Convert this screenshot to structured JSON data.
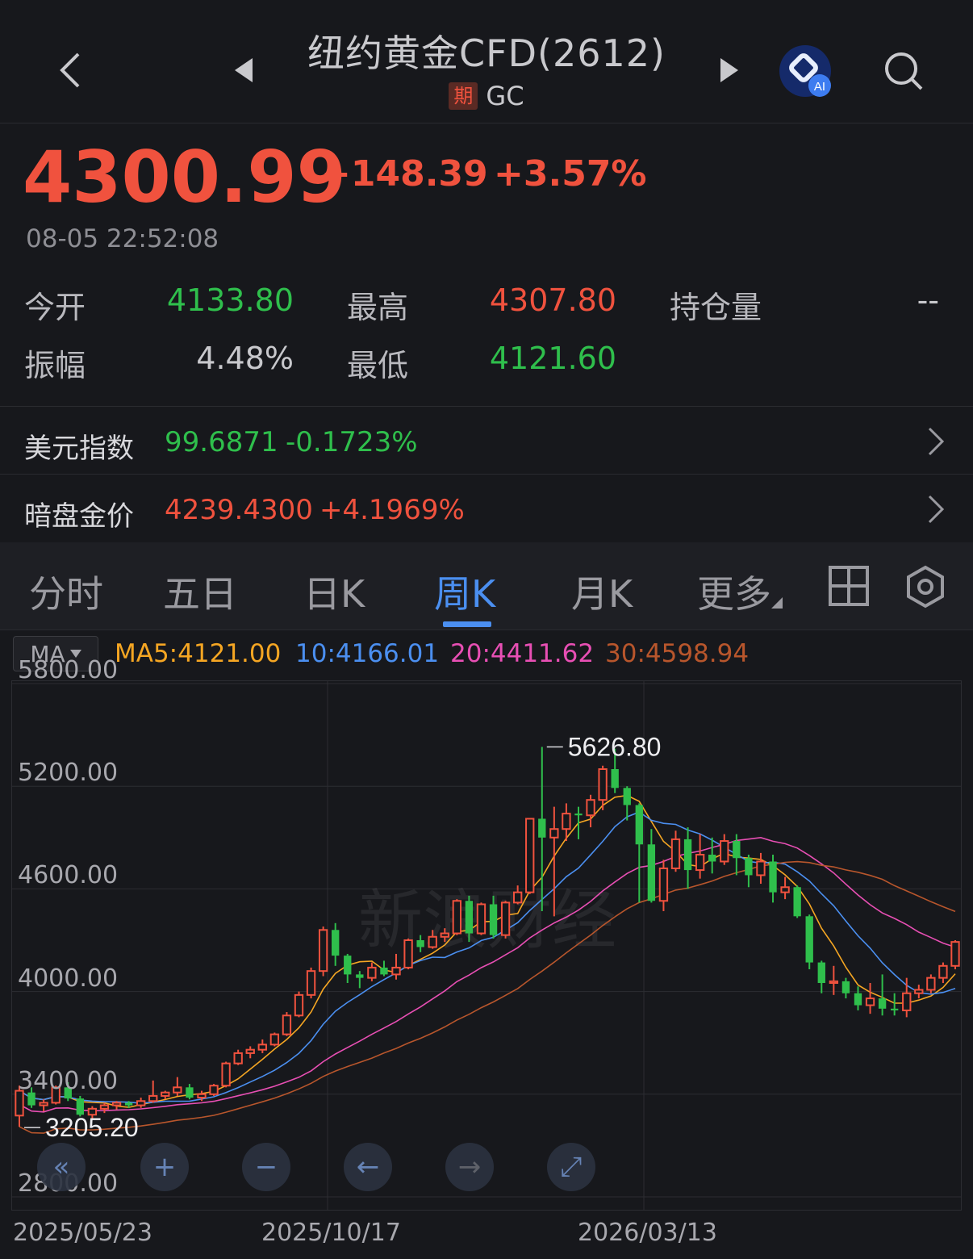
{
  "header": {
    "title": "纽约黄金CFD(2612)",
    "badge": "期",
    "code": "GC"
  },
  "quote": {
    "price": "4300.99",
    "change": "+148.39",
    "change_pct": "+3.57%",
    "time": "08-05 22:52:08",
    "open_label": "今开",
    "open": "4133.80",
    "high_label": "最高",
    "high": "4307.80",
    "oi_label": "持仓量",
    "oi": "--",
    "amp_label": "振幅",
    "amp": "4.48%",
    "low_label": "最低",
    "low": "4121.60"
  },
  "related": [
    {
      "label": "美元指数",
      "value": "99.6871",
      "change": "-0.1723%"
    },
    {
      "label": "暗盘金价",
      "value": "4239.4300",
      "change": "+4.1969%"
    }
  ],
  "tabs": [
    {
      "label": "分时"
    },
    {
      "label": "五日"
    },
    {
      "label": "日K"
    },
    {
      "label": "周K"
    },
    {
      "label": "月K"
    },
    {
      "label": "更多"
    }
  ],
  "ma": {
    "selector": "MA",
    "ma5": "MA5:4121.00",
    "ma10": "10:4166.01",
    "ma20": "20:4411.62",
    "ma30": "30:4598.94",
    "colors": {
      "ma5": "#f5a623",
      "ma10": "#4b8ff0",
      "ma20": "#e84fb4",
      "ma30": "#b8562c"
    }
  },
  "colors": {
    "up": "#f0523e",
    "down": "#2fbf4c",
    "accent": "#4b8ff0"
  },
  "chart_data": {
    "type": "candlestick",
    "y_ticks": [
      "5800.00",
      "5200.00",
      "4600.00",
      "4000.00",
      "3400.00",
      "2800.00"
    ],
    "ylim": [
      2800,
      5800
    ],
    "x_ticks": [
      "2025/05/23",
      "2025/10/17",
      "2026/03/13"
    ],
    "max_label": "5626.80",
    "min_label": "3205.20",
    "watermark": "新浪财经",
    "candles": [
      [
        3275,
        3420,
        3210,
        3450
      ],
      [
        3410,
        3335,
        3320,
        3440
      ],
      [
        3335,
        3350,
        3300,
        3370
      ],
      [
        3350,
        3440,
        3340,
        3450
      ],
      [
        3440,
        3375,
        3360,
        3470
      ],
      [
        3375,
        3280,
        3270,
        3390
      ],
      [
        3280,
        3315,
        3260,
        3330
      ],
      [
        3315,
        3335,
        3290,
        3350
      ],
      [
        3335,
        3350,
        3310,
        3360
      ],
      [
        3350,
        3335,
        3320,
        3360
      ],
      [
        3335,
        3360,
        3320,
        3380
      ],
      [
        3360,
        3390,
        3350,
        3480
      ],
      [
        3390,
        3410,
        3370,
        3420
      ],
      [
        3410,
        3440,
        3390,
        3500
      ],
      [
        3440,
        3380,
        3370,
        3460
      ],
      [
        3380,
        3400,
        3360,
        3420
      ],
      [
        3400,
        3450,
        3390,
        3460
      ],
      [
        3450,
        3580,
        3440,
        3590
      ],
      [
        3580,
        3640,
        3570,
        3660
      ],
      [
        3640,
        3660,
        3610,
        3680
      ],
      [
        3660,
        3690,
        3640,
        3720
      ],
      [
        3690,
        3750,
        3680,
        3760
      ],
      [
        3750,
        3860,
        3740,
        3880
      ],
      [
        3860,
        3980,
        3850,
        4000
      ],
      [
        3980,
        4120,
        3960,
        4140
      ],
      [
        4120,
        4360,
        4090,
        4380
      ],
      [
        4360,
        4210,
        4150,
        4400
      ],
      [
        4210,
        4100,
        4050,
        4220
      ],
      [
        4100,
        4080,
        4020,
        4120
      ],
      [
        4080,
        4140,
        4060,
        4170
      ],
      [
        4140,
        4100,
        4090,
        4180
      ],
      [
        4100,
        4140,
        4070,
        4220
      ],
      [
        4140,
        4300,
        4130,
        4310
      ],
      [
        4300,
        4260,
        4230,
        4330
      ],
      [
        4260,
        4320,
        4250,
        4360
      ],
      [
        4320,
        4340,
        4290,
        4370
      ],
      [
        4340,
        4530,
        4330,
        4540
      ],
      [
        4530,
        4340,
        4290,
        4560
      ],
      [
        4340,
        4510,
        4330,
        4520
      ],
      [
        4510,
        4330,
        4310,
        4560
      ],
      [
        4330,
        4520,
        4310,
        4530
      ],
      [
        4520,
        4580,
        4510,
        4620
      ],
      [
        4580,
        5010,
        4570,
        5010
      ],
      [
        5010,
        4900,
        4470,
        5430
      ],
      [
        4900,
        4950,
        4440,
        5080
      ],
      [
        4950,
        5040,
        4880,
        5100
      ],
      [
        5040,
        5030,
        4890,
        5080
      ],
      [
        5030,
        5120,
        4960,
        5150
      ],
      [
        5120,
        5300,
        5060,
        5320
      ],
      [
        5300,
        5190,
        5160,
        5420
      ],
      [
        5190,
        5090,
        5000,
        5200
      ],
      [
        5090,
        4860,
        4520,
        5100
      ],
      [
        4860,
        4530,
        4520,
        4950
      ],
      [
        4530,
        4720,
        4470,
        4770
      ],
      [
        4720,
        4890,
        4700,
        4940
      ],
      [
        4890,
        4710,
        4600,
        4960
      ],
      [
        4710,
        4800,
        4660,
        4920
      ],
      [
        4800,
        4760,
        4690,
        4900
      ],
      [
        4760,
        4880,
        4740,
        4920
      ],
      [
        4880,
        4780,
        4680,
        4920
      ],
      [
        4780,
        4680,
        4610,
        4800
      ],
      [
        4680,
        4760,
        4630,
        4810
      ],
      [
        4760,
        4580,
        4520,
        4800
      ],
      [
        4580,
        4610,
        4540,
        4670
      ],
      [
        4610,
        4440,
        4430,
        4620
      ],
      [
        4440,
        4170,
        4130,
        4450
      ],
      [
        4170,
        4050,
        3990,
        4180
      ],
      [
        4050,
        4060,
        3980,
        4150
      ],
      [
        4060,
        3990,
        3960,
        4080
      ],
      [
        3990,
        3920,
        3890,
        4030
      ],
      [
        3920,
        3960,
        3870,
        4050
      ],
      [
        3960,
        3900,
        3860,
        4100
      ],
      [
        3900,
        3890,
        3860,
        3990
      ],
      [
        3890,
        3990,
        3850,
        4080
      ],
      [
        3990,
        4010,
        3960,
        4040
      ],
      [
        4010,
        4080,
        3990,
        4100
      ],
      [
        4080,
        4150,
        4050,
        4170
      ],
      [
        4150,
        4290,
        4130,
        4300
      ]
    ],
    "candle_x": [
      [
        0,
        22
      ],
      [
        1,
        40
      ],
      [
        2,
        58
      ],
      [
        3,
        78
      ],
      [
        4,
        96
      ],
      [
        5,
        115
      ],
      [
        6,
        132
      ],
      [
        7,
        150
      ],
      [
        8,
        168
      ],
      [
        9,
        188
      ],
      [
        10,
        205
      ],
      [
        11,
        224
      ],
      [
        12,
        242
      ],
      [
        13,
        262
      ],
      [
        14,
        280
      ],
      [
        15,
        298
      ],
      [
        16,
        316
      ],
      [
        17,
        334
      ],
      [
        18,
        352
      ],
      [
        19,
        372
      ],
      [
        20,
        390
      ],
      [
        21,
        408
      ],
      [
        22,
        426
      ],
      [
        23,
        446
      ],
      [
        24,
        464
      ],
      [
        25,
        482
      ],
      [
        26,
        500
      ],
      [
        27,
        518
      ],
      [
        28,
        538
      ],
      [
        29,
        556
      ],
      [
        30,
        574
      ],
      [
        31,
        592
      ],
      [
        32,
        610
      ],
      [
        33,
        628
      ],
      [
        34,
        646
      ],
      [
        35,
        664
      ],
      [
        36,
        682
      ],
      [
        37,
        700
      ],
      [
        38,
        718
      ],
      [
        39,
        738
      ],
      [
        40,
        756
      ],
      [
        41,
        774
      ],
      [
        42,
        792
      ],
      [
        43,
        810
      ],
      [
        44,
        828
      ],
      [
        45,
        846
      ],
      [
        46,
        864
      ],
      [
        47,
        882
      ],
      [
        48,
        900
      ],
      [
        49,
        918
      ],
      [
        50,
        936
      ],
      [
        51,
        954
      ],
      [
        52,
        972
      ],
      [
        53,
        990
      ],
      [
        54,
        1008
      ],
      [
        55,
        1026
      ],
      [
        56,
        1044
      ],
      [
        57,
        1062
      ],
      [
        58,
        1080
      ],
      [
        59,
        1098
      ],
      [
        60,
        1116
      ],
      [
        61,
        1134
      ],
      [
        62,
        1152
      ],
      [
        63,
        1170
      ],
      [
        64,
        1188
      ],
      [
        65,
        1206
      ],
      [
        66,
        1224
      ],
      [
        67,
        1242
      ],
      [
        68,
        1260
      ],
      [
        69,
        1278
      ],
      [
        70,
        1296
      ],
      [
        71,
        1314
      ],
      [
        72,
        1332
      ],
      [
        73,
        1350
      ],
      [
        74,
        1368
      ],
      [
        75,
        1386
      ],
      [
        76,
        1404
      ],
      [
        77,
        1422
      ]
    ]
  }
}
